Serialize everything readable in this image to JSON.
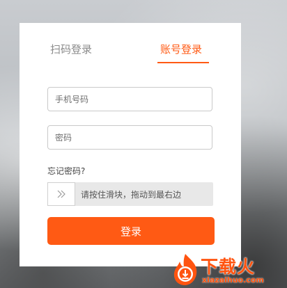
{
  "tabs": {
    "qr_label": "扫码登录",
    "account_label": "账号登录",
    "active_color": "#ff5a14",
    "inactive_color": "#8a8a8a"
  },
  "form": {
    "phone_placeholder": "手机号码",
    "phone_value": "",
    "password_placeholder": "密码",
    "password_value": "",
    "forgot_label": "忘记密码?",
    "slider_hint": "请按住滑块，拖动到最右边",
    "slider_progress": 0,
    "submit_label": "登录",
    "accent_color": "#ff5a14"
  },
  "icons": {
    "slider_handle": "double-chevron-right-icon",
    "watermark_logo": "flame-download-icon"
  },
  "watermark": {
    "brand": "下载火",
    "url": "xiazaihuo.com"
  }
}
